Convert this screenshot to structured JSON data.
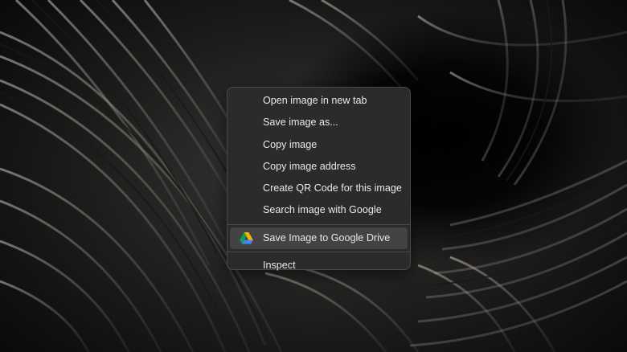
{
  "context_menu": {
    "items": [
      {
        "label": "Open image in new tab"
      },
      {
        "label": "Save image as..."
      },
      {
        "label": "Copy image"
      },
      {
        "label": "Copy image address"
      },
      {
        "label": "Create QR Code for this image"
      },
      {
        "label": "Search image with Google"
      }
    ],
    "extension_item": {
      "label": "Save Image to Google Drive",
      "icon": "google-drive-icon"
    },
    "footer_item": {
      "label": "Inspect"
    }
  },
  "colors": {
    "menu_background": "#2b2b2d",
    "menu_border": "#4a4a4d",
    "menu_text": "#e8e8e8",
    "highlight": "#434346",
    "drive_green": "#0f9d58",
    "drive_yellow": "#f4b400",
    "drive_blue": "#4285f4"
  }
}
